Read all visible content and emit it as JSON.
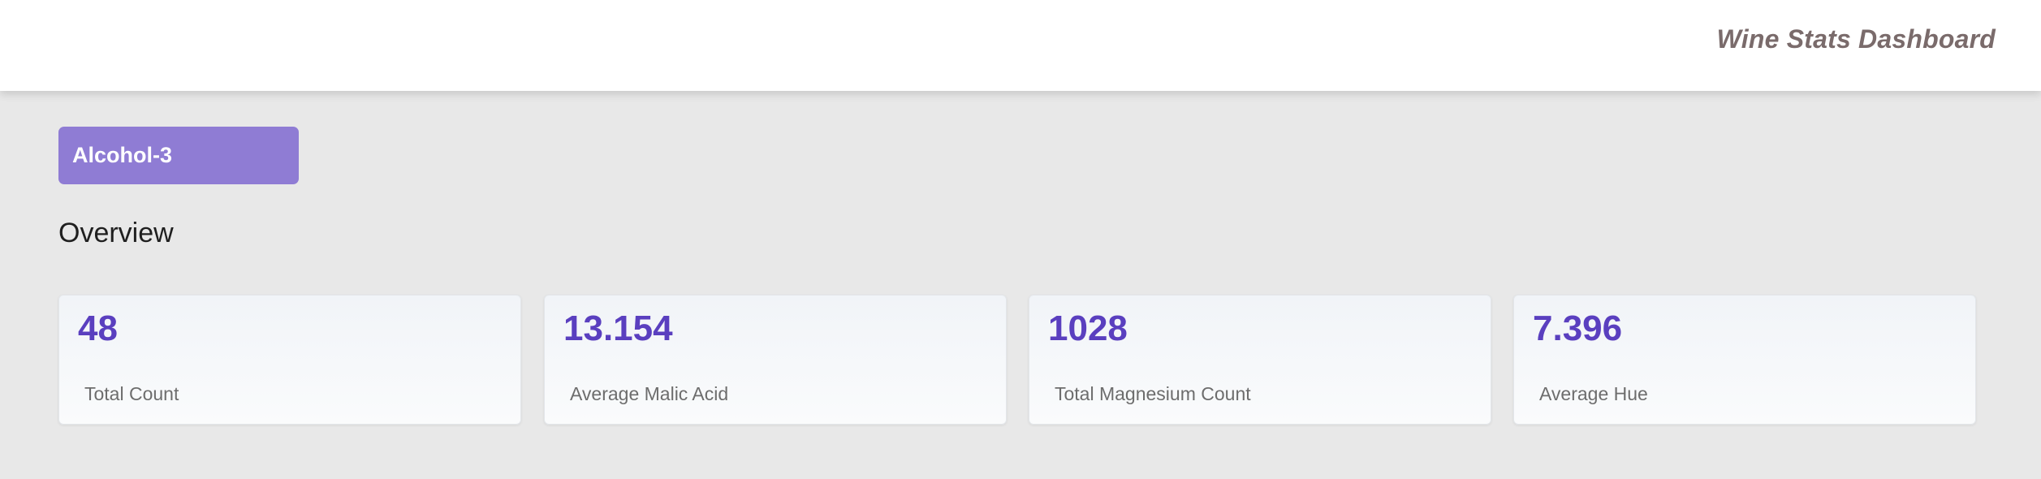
{
  "header": {
    "title": "Wine Stats Dashboard"
  },
  "filter": {
    "label": "Alcohol-3"
  },
  "overview": {
    "title": "Overview",
    "cards": [
      {
        "value": "48",
        "label": "Total Count"
      },
      {
        "value": "13.154",
        "label": "Average Malic Acid"
      },
      {
        "value": "1028",
        "label": "Total Magnesium Count"
      },
      {
        "value": "7.396",
        "label": "Average Hue"
      }
    ]
  },
  "colors": {
    "accent": "#8f7cd4",
    "value_text": "#5a3fbf",
    "background": "#e8e8e8",
    "header_text": "#7a6b6b"
  }
}
